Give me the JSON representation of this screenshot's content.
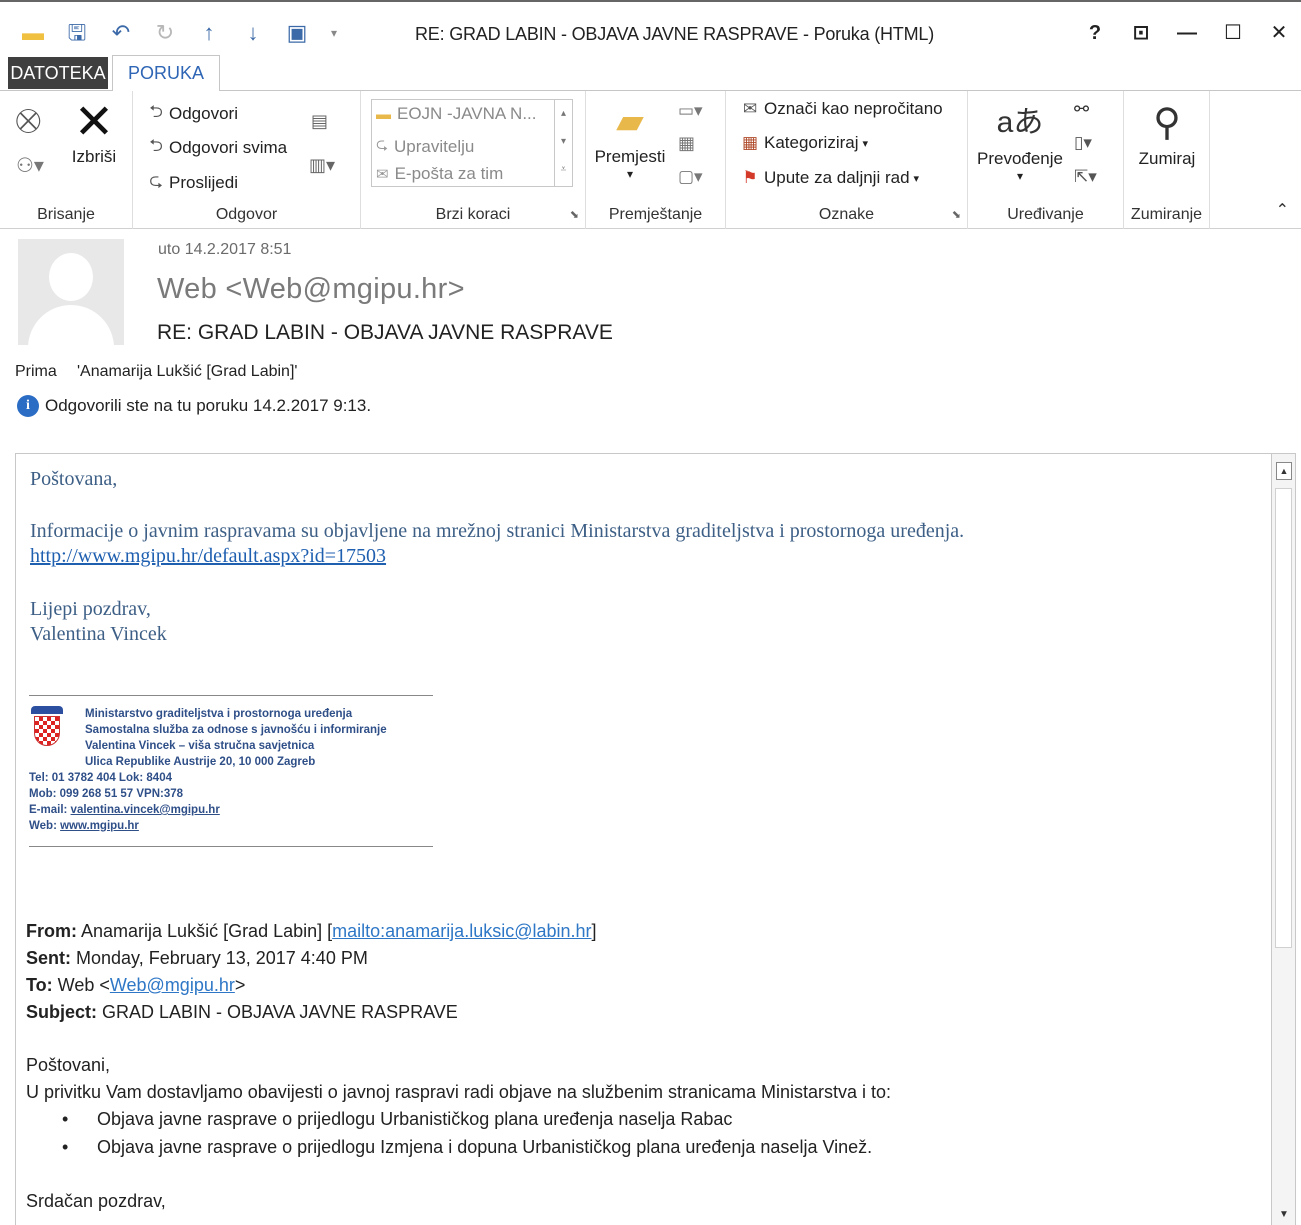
{
  "window": {
    "title": "RE: GRAD LABIN - OBJAVA JAVNE RASPRAVE - Poruka (HTML)",
    "help": "?",
    "restore_icon": "ribbon-display-icon",
    "minimize": "—",
    "maximize": "☐",
    "close": "✕"
  },
  "tabs": {
    "file": "DATOTEKA",
    "message": "PORUKA"
  },
  "ribbon": {
    "delete": {
      "label": "Brisanje",
      "delete_button": "Izbriši"
    },
    "respond": {
      "label": "Odgovor",
      "reply": "Odgovori",
      "reply_all": "Odgovori svima",
      "forward": "Proslijedi"
    },
    "quick_steps": {
      "label": "Brzi koraci",
      "items": [
        "EOJN -JAVNA N...",
        "Upravitelju",
        "E-pošta za tim"
      ]
    },
    "move": {
      "label": "Premještanje",
      "move_button": "Premjesti"
    },
    "tags": {
      "label": "Oznake",
      "mark_unread": "Označi kao nepročitano",
      "categorize": "Kategoriziraj",
      "follow_up": "Upute za daljnji rad"
    },
    "editing": {
      "label": "Uređivanje",
      "translate": "Prevođenje"
    },
    "zoom": {
      "label": "Zumiranje",
      "zoom_button": "Zumiraj"
    }
  },
  "header": {
    "date": "uto 14.2.2017 8:51",
    "from": "Web <Web@mgipu.hr>",
    "subject": "RE: GRAD LABIN - OBJAVA JAVNE RASPRAVE",
    "to_label": "Prima",
    "to": "'Anamarija Lukšić [Grad Labin]'",
    "info": "Odgovorili ste na tu poruku 14.2.2017 9:13."
  },
  "body": {
    "greeting": "Poštovana,",
    "info": "Informacije o javnim raspravama su objavljene na mrežnoj stranici Ministarstva graditeljstva i prostornoga uređenja.",
    "link": "http://www.mgipu.hr/default.aspx?id=17503",
    "regards": "Lijepi pozdrav,",
    "name": "Valentina Vincek",
    "signature": {
      "line1": "Ministarstvo graditeljstva i prostornoga uređenja",
      "line2": "Samostalna služba za odnose s javnošću i informiranje",
      "line3": "Valentina Vincek – viša stručna savjetnica",
      "line4": "Ulica Republike Austrije 20, 10 000 Zagreb",
      "tel": "Tel: 01 3782 404    Lok: 8404",
      "mob": "Mob: 099 268 51 57    VPN:378",
      "email_label": "E-mail: ",
      "email": "valentina.vincek@mgipu.hr",
      "web_label": "Web: ",
      "web": "www.mgipu.hr"
    },
    "forwarded": {
      "from_label": "From:",
      "from": " Anamarija Lukšić [Grad Labin] [",
      "from_link": "mailto:anamarija.luksic@labin.hr",
      "from_end": "]",
      "sent_label": "Sent:",
      "sent": " Monday, February 13, 2017 4:40 PM",
      "to_label": "To:",
      "to": " Web <",
      "to_link": "Web@mgipu.hr",
      "to_end": ">",
      "subject_label": "Subject:",
      "subject": " GRAD LABIN - OBJAVA JAVNE RASPRAVE",
      "greeting": "Poštovani,",
      "intro": "U privitku Vam dostavljamo obavijesti o javnoj raspravi  radi objave na službenim stranicama Ministarstva i to:",
      "bullet_char": "•",
      "bullets": [
        "Objava javne rasprave o prijedlogu Urbanističkog plana uređenja naselja Rabac",
        "Objava javne rasprave o prijedlogu Izmjena i dopuna Urbanističkog plana uređenja naselja Vinež."
      ],
      "closing": "Srdačan pozdrav,"
    }
  }
}
